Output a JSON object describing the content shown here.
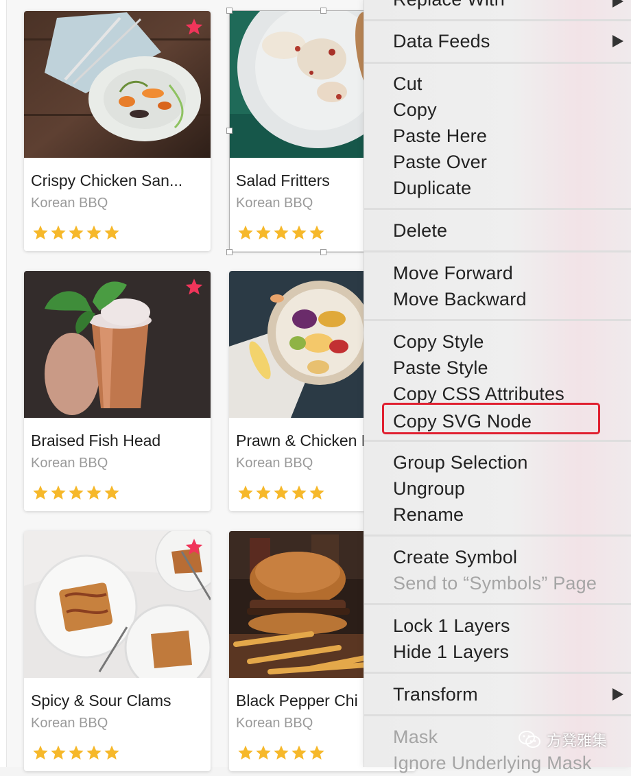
{
  "cards": [
    {
      "title": "Crispy Chicken San...",
      "subtitle": "Korean BBQ",
      "rating": 5,
      "favorite": true,
      "image": "plated-vegetables-photo"
    },
    {
      "title": "Salad Fritters",
      "subtitle": "Korean BBQ",
      "rating": 5,
      "favorite": false,
      "image": "fritters-plate-photo"
    },
    {
      "title": "Braised Fish Head",
      "subtitle": "Korean BBQ",
      "rating": 5,
      "favorite": true,
      "image": "copper-cup-drink-photo"
    },
    {
      "title": "Prawn & Chicken Roll",
      "subtitle": "Korean BBQ",
      "rating": 5,
      "favorite": false,
      "image": "fruit-platter-photo"
    },
    {
      "title": "Spicy & Sour Clams",
      "subtitle": "Korean BBQ",
      "rating": 5,
      "favorite": true,
      "image": "apple-tart-photo"
    },
    {
      "title": "Black Pepper Chi",
      "subtitle": "Korean BBQ",
      "rating": 5,
      "favorite": false,
      "image": "burger-fries-photo"
    }
  ],
  "menu": {
    "replace_with": "Replace With",
    "data_feeds": "Data Feeds",
    "cut": "Cut",
    "copy": "Copy",
    "paste_here": "Paste Here",
    "paste_over": "Paste Over",
    "duplicate": "Duplicate",
    "delete": "Delete",
    "move_forward": "Move Forward",
    "move_backward": "Move Backward",
    "copy_style": "Copy Style",
    "paste_style": "Paste Style",
    "copy_css": "Copy CSS Attributes",
    "copy_svg": "Copy SVG Node",
    "group_selection": "Group Selection",
    "ungroup": "Ungroup",
    "rename": "Rename",
    "create_symbol": "Create Symbol",
    "send_to_symbols": "Send to “Symbols” Page",
    "lock_layers": "Lock 1 Layers",
    "hide_layers": "Hide 1 Layers",
    "transform": "Transform",
    "mask": "Mask",
    "ignore_mask": "Ignore Underlying Mask"
  },
  "watermark": {
    "text": "方凳雅集",
    "icon": "wechat-icon"
  },
  "colors": {
    "star": "#f6b82a",
    "favorite": "#f0355a",
    "highlight": "#e02030"
  }
}
